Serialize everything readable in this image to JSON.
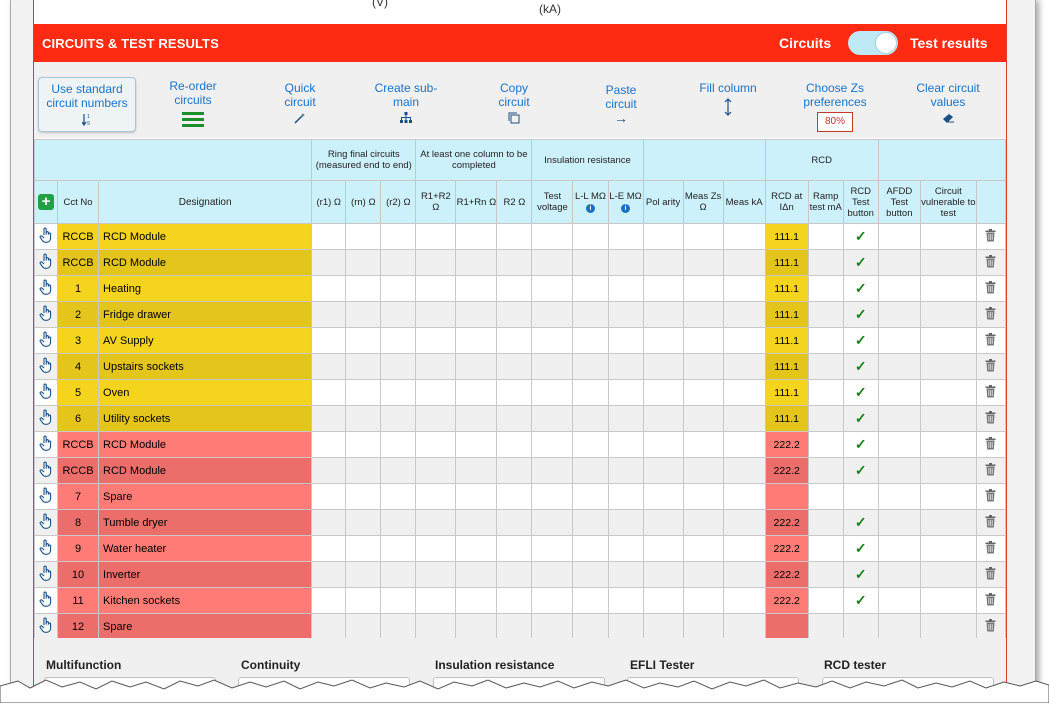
{
  "top_units": [
    "(V)",
    "(kA)"
  ],
  "section": {
    "title": "CIRCUITS & TEST RESULTS",
    "toggle_left": "Circuits",
    "toggle_right": "Test results"
  },
  "toolbar": {
    "use_standard": "Use standard circuit numbers",
    "reorder": "Re-order circuits",
    "quick": "Quick circuit",
    "create_sub": "Create sub-main",
    "copy": "Copy circuit",
    "paste": "Paste circuit",
    "fill": "Fill column",
    "choose_zs": "Choose Zs preferences",
    "choose_zs_value": "80%",
    "clear": "Clear circuit values"
  },
  "groups": {
    "ring": "Ring final circuits (measured end to end)",
    "atleast": "At least one column to be completed",
    "insulation": "Insulation resistance",
    "rcd": "RCD"
  },
  "columns": {
    "cct": "Cct No",
    "designation": "Designation",
    "r1": "(r1) Ω",
    "rn": "(rn) Ω",
    "r2": "(r2) Ω",
    "r1r2": "R1+R2 Ω",
    "r1rn": "R1+Rn Ω",
    "r2b": "R2 Ω",
    "test_voltage": "Test voltage",
    "ll": "L-L MΩ",
    "le": "L-E MΩ",
    "polarity": "Pol arity",
    "meas_zs": "Meas Zs Ω",
    "meas_ka": "Meas kA",
    "rcd_at": "RCD at IΔn",
    "ramp": "Ramp test mA",
    "rcd_btn": "RCD Test button",
    "afdd": "AFDD Test button",
    "vulnerable": "Circuit vulnerable to test"
  },
  "rows": [
    {
      "cct": "RCCB",
      "designation": "RCD Module",
      "rcd": "111.1",
      "tick": "✓",
      "color": "y"
    },
    {
      "cct": "RCCB",
      "designation": "RCD Module",
      "rcd": "111.1",
      "tick": "✓",
      "color": "y"
    },
    {
      "cct": "1",
      "designation": "Heating",
      "rcd": "111.1",
      "tick": "✓",
      "color": "y"
    },
    {
      "cct": "2",
      "designation": "Fridge drawer",
      "rcd": "111.1",
      "tick": "✓",
      "color": "y"
    },
    {
      "cct": "3",
      "designation": "AV Supply",
      "rcd": "111.1",
      "tick": "✓",
      "color": "y"
    },
    {
      "cct": "4",
      "designation": "Upstairs sockets",
      "rcd": "111.1",
      "tick": "✓",
      "color": "y"
    },
    {
      "cct": "5",
      "designation": "Oven",
      "rcd": "111.1",
      "tick": "✓",
      "color": "y"
    },
    {
      "cct": "6",
      "designation": "Utility sockets",
      "rcd": "111.1",
      "tick": "✓",
      "color": "y"
    },
    {
      "cct": "RCCB",
      "designation": "RCD Module",
      "rcd": "222.2",
      "tick": "✓",
      "color": "r"
    },
    {
      "cct": "RCCB",
      "designation": "RCD Module",
      "rcd": "222.2",
      "tick": "✓",
      "color": "r"
    },
    {
      "cct": "7",
      "designation": "Spare",
      "rcd": "",
      "tick": "",
      "color": "r"
    },
    {
      "cct": "8",
      "designation": "Tumble dryer",
      "rcd": "222.2",
      "tick": "✓",
      "color": "r"
    },
    {
      "cct": "9",
      "designation": "Water heater",
      "rcd": "222.2",
      "tick": "✓",
      "color": "r"
    },
    {
      "cct": "10",
      "designation": "Inverter",
      "rcd": "222.2",
      "tick": "✓",
      "color": "r"
    },
    {
      "cct": "11",
      "designation": "Kitchen sockets",
      "rcd": "222.2",
      "tick": "✓",
      "color": "r"
    },
    {
      "cct": "12",
      "designation": "Spare",
      "rcd": "",
      "tick": "",
      "color": "r"
    }
  ],
  "equipment": {
    "multifunction": "Multifunction",
    "continuity": "Continuity",
    "insulation": "Insulation resistance",
    "efli": "EFLI Tester",
    "rcd": "RCD tester"
  },
  "icons": {
    "row_handle": "hand-pointer-icon",
    "row_delete": "trash-icon",
    "add": "plus-icon"
  },
  "colors": {
    "accent": "#ff2a12",
    "yellow_group": "#f4d41c",
    "red_group": "#ff7b76",
    "header": "#cdf1fa",
    "link": "#1a73c8"
  }
}
